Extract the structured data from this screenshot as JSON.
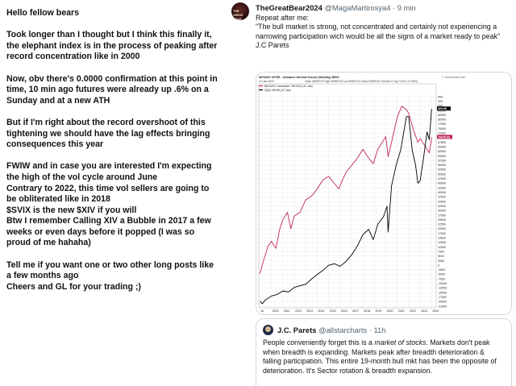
{
  "left_post": {
    "paragraphs": [
      "Hello fellow bears",
      "Took longer than I thought but I think this finally it, the elephant index is in the process of peaking after record concentration like in 2000",
      "Now, obv there's 0.0000 confirmation at this point in time, 10 min ago futures were already up .6% on a Sunday and at a new ATH",
      "But if I'm right about the record overshoot of this tightening we should have the lag effects bringing consequences this year",
      "FWIW and in case you are interested I'm expecting the high of the vol cycle around June\nContrary to 2022, this time vol sellers are going to be obliterated like in 2018\n$SVIX is the new $XIV if you will\nBtw I remember Calling XIV a Bubble in 2017 a few weeks or even days before it popped (I was so proud of me hahaha)",
      "Tell me if you want one or two other long posts like a few months ago\nCheers and GL for your trading ;)"
    ]
  },
  "tweet": {
    "avatar_text": "THE GREAT BEAR",
    "author_name": "TheGreatBear2024",
    "handle": "@MagaMartirosya4",
    "separator": "·",
    "time": "9 min",
    "lines": [
      "Repeat after me:",
      "\"The bull market is strong, not concentrated and certainly not experiencing a narrowing participation wich would be all the signs of a market ready to peak\"",
      "J.C Parets"
    ]
  },
  "quote": {
    "author_name": "J.C. Parets",
    "handle": "@allstarcharts",
    "separator": "·",
    "time": "11h",
    "text_before": "People conveniently forget this is a ",
    "text_em": "market of stocks",
    "text_after": ". Markets don't peak when breadth is expanding. Markets peak after breadth deterioration & falling participation. This entire 19-month bull mkt has been the opposite of deterioration. It's Sector rotation & breadth expansion."
  },
  "chart_header": {
    "ticker_line": "$NYADV NYSE - Advance Decline Issues (Weekly) INDX",
    "date_line": "12-Jan-2024",
    "ohlc_line": "Open 69699.00  High 69699.00  Low 69699.00  Close 69699.00  Volume 0  Chg +0.00 (+0.00%)",
    "legend_1": "$NYADV Cumulative 70678.00 (12 Jan)",
    "legend_2": "QQQ 409.85 (12 Jan)",
    "watermark": "© StockCharts.com"
  },
  "chart_data": {
    "type": "line",
    "x_label_ticks": [
      "16",
      "2010",
      "2011",
      "2012",
      "2013",
      "2014",
      "2015",
      "2016",
      "2017",
      "2018",
      "2019",
      "2020",
      "2021",
      "2022",
      "2023",
      "2024"
    ],
    "y_ticks": [
      "400",
      "325",
      "300",
      "85000",
      "82500",
      "80000",
      "77500",
      "75000",
      "72500",
      "70000",
      "67500",
      "65000",
      "62500",
      "60000",
      "57500",
      "55000",
      "52500",
      "50000",
      "47500",
      "45000",
      "42500",
      "40000",
      "37500",
      "35000",
      "32500",
      "30000",
      "27500",
      "25000",
      "22500",
      "20000",
      "17500",
      "15000",
      "12500",
      "10000",
      "7500",
      "5000",
      "2500",
      "0",
      "-2500",
      "-5000",
      "-7500",
      "-10000",
      "-12500",
      "-15000",
      "-17500",
      "-20000",
      "-22500"
    ],
    "price_labels": [
      "409.85",
      "70678.00"
    ],
    "series": [
      {
        "name": "$NYADV Cumulative",
        "color": "#c0245c",
        "x": [
          2009.0,
          2009.3,
          2009.7,
          2010.0,
          2010.4,
          2010.7,
          2011.0,
          2011.4,
          2011.7,
          2012.0,
          2012.5,
          2013.0,
          2013.5,
          2014.0,
          2014.5,
          2015.0,
          2015.5,
          2015.9,
          2016.2,
          2016.6,
          2017.0,
          2017.5,
          2018.0,
          2018.4,
          2018.9,
          2019.3,
          2019.8,
          2020.0,
          2020.2,
          2020.5,
          2021.0,
          2021.4,
          2021.8,
          2022.0,
          2022.4,
          2022.8,
          2023.0,
          2023.4,
          2023.8,
          2024.0
        ],
        "values": [
          -5000,
          2000,
          10000,
          13000,
          9000,
          19000,
          25000,
          29000,
          20000,
          27000,
          29000,
          36000,
          38000,
          42000,
          47000,
          49000,
          45000,
          42000,
          47000,
          52000,
          55000,
          59000,
          64000,
          60000,
          56000,
          64000,
          69000,
          71000,
          60000,
          68000,
          82000,
          88000,
          86000,
          84000,
          75000,
          68000,
          70000,
          66000,
          62000,
          70678
        ]
      },
      {
        "name": "QQQ",
        "color": "#000000",
        "x": [
          2009.0,
          2009.2,
          2009.5,
          2010.0,
          2010.5,
          2011.0,
          2011.5,
          2012.0,
          2012.5,
          2013.0,
          2013.5,
          2014.0,
          2014.5,
          2015.0,
          2015.5,
          2016.0,
          2016.5,
          2017.0,
          2017.5,
          2018.0,
          2018.5,
          2018.9,
          2019.3,
          2019.8,
          2020.1,
          2020.2,
          2020.5,
          2020.9,
          2021.3,
          2021.8,
          2022.0,
          2022.3,
          2022.6,
          2022.8,
          2023.0,
          2023.3,
          2023.6,
          2023.8,
          2024.0
        ],
        "values": [
          35,
          30,
          38,
          45,
          48,
          55,
          53,
          62,
          65,
          68,
          78,
          87,
          95,
          105,
          108,
          103,
          112,
          125,
          142,
          165,
          175,
          155,
          185,
          200,
          220,
          170,
          260,
          300,
          330,
          395,
          395,
          330,
          300,
          265,
          270,
          315,
          365,
          350,
          409.85
        ]
      }
    ]
  }
}
